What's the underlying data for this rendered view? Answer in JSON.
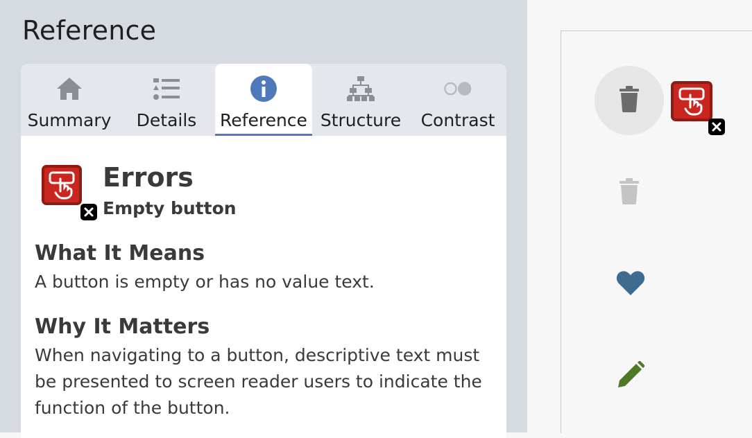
{
  "panel": {
    "title": "Reference"
  },
  "tabs": [
    {
      "label": "Summary",
      "icon": "home-icon"
    },
    {
      "label": "Details",
      "icon": "list-icon"
    },
    {
      "label": "Reference",
      "icon": "info-icon",
      "active": true
    },
    {
      "label": "Structure",
      "icon": "hierarchy-icon"
    },
    {
      "label": "Contrast",
      "icon": "contrast-icon"
    }
  ],
  "reference": {
    "category": "Errors",
    "item": "Empty button",
    "sections": [
      {
        "heading": "What It Means",
        "text": "A button is empty or has no value text."
      },
      {
        "heading": "Why It Matters",
        "text": "When navigating to a button, descriptive text must be presented to screen reader users to indicate the function of the button."
      }
    ]
  },
  "preview": {
    "icons": [
      "trash-icon",
      "empty-button-error-icon",
      "trash-icon",
      "heart-icon",
      "pencil-icon"
    ]
  },
  "colors": {
    "accent": "#4f79ba",
    "error": "#c8261e",
    "heart": "#3f6b8e",
    "pencil": "#4e7a27"
  }
}
